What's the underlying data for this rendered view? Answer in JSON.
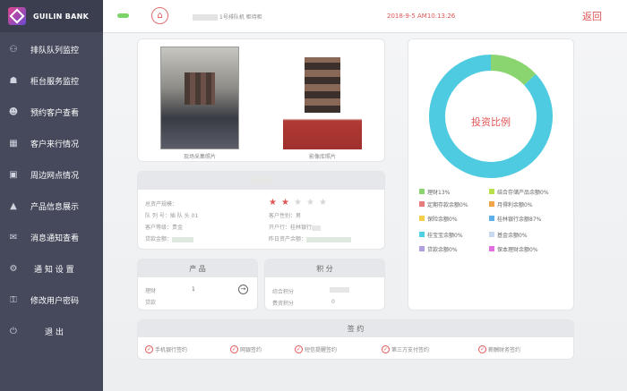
{
  "app": {
    "brand": "GUILIN BANK"
  },
  "sidebar": {
    "items": [
      {
        "label": "排队队列监控",
        "icon": "queue-monitor-icon"
      },
      {
        "label": "柜台服务监控",
        "icon": "counter-service-icon"
      },
      {
        "label": "预约客户查看",
        "icon": "appointment-icon"
      },
      {
        "label": "客户来行情况",
        "icon": "calendar-icon"
      },
      {
        "label": "周边网点情况",
        "icon": "branch-icon"
      },
      {
        "label": "产品信息展示",
        "icon": "product-icon"
      },
      {
        "label": "消息通知查看",
        "icon": "message-icon"
      },
      {
        "label": "通 知 设 置",
        "icon": "settings-icon"
      },
      {
        "label": "修改用户密码",
        "icon": "password-icon"
      },
      {
        "label": "退 出",
        "icon": "power-icon"
      }
    ]
  },
  "topbar": {
    "queue_info": "1号排队机 柜待柜",
    "timestamp": "2018-9-5 AM10:13:26",
    "back": "返回"
  },
  "photos": {
    "capture_caption": "现场采集照片",
    "library_caption": "影像库照片"
  },
  "customer": {
    "rows_left": [
      {
        "label": "总资产规模："
      },
      {
        "label": "队 列 号：插 队 头 01"
      },
      {
        "label": "客户等级：贵金"
      },
      {
        "label": "贷款金额："
      }
    ],
    "rows_right": [
      {
        "label": "客户性别：男"
      },
      {
        "label": "开户行：桂林银行"
      },
      {
        "label": "昨日资产余额："
      }
    ],
    "rating": {
      "value": 2,
      "max": 5
    }
  },
  "products": {
    "title": "产 品",
    "rows": [
      {
        "label": "理财",
        "value": "1"
      },
      {
        "label": "贷款",
        "value": ""
      }
    ]
  },
  "points": {
    "title": "积 分",
    "rows": [
      {
        "label": "综合积分",
        "value": ""
      },
      {
        "label": "费资积分",
        "value": "0"
      }
    ]
  },
  "investment": {
    "title": "投资比例",
    "legend": [
      {
        "label": "理财13%",
        "color": "#8ad56f"
      },
      {
        "label": "结合存储产品余额0%",
        "color": "#b8e04a"
      },
      {
        "label": "定期存款余额0%",
        "color": "#e77c7c"
      },
      {
        "label": "月得利余额0%",
        "color": "#f0a44a"
      },
      {
        "label": "保险余额0%",
        "color": "#f5cf4a"
      },
      {
        "label": "桂林银行余额87%",
        "color": "#5fb0e8"
      },
      {
        "label": "桂宝宝余额0%",
        "color": "#4dd0e1"
      },
      {
        "label": "基金余额0%",
        "color": "#c8d8f0"
      },
      {
        "label": "贷款余额0%",
        "color": "#b0a0e0"
      },
      {
        "label": "保本理财余额0%",
        "color": "#e070e0"
      }
    ]
  },
  "chart_data": {
    "type": "pie",
    "title": "投资比例",
    "categories": [
      "理财",
      "结合存储产品",
      "定期存款",
      "月得利",
      "保险",
      "桂林银行",
      "桂宝宝",
      "基金",
      "贷款",
      "保本理财"
    ],
    "values": [
      13,
      0,
      0,
      0,
      0,
      87,
      0,
      0,
      0,
      0
    ],
    "colors": [
      "#8ad56f",
      "#b8e04a",
      "#e77c7c",
      "#f0a44a",
      "#f5cf4a",
      "#4ecbe0",
      "#4dd0e1",
      "#c8d8f0",
      "#b0a0e0",
      "#e070e0"
    ]
  },
  "signing": {
    "title": "签 约",
    "items": [
      "手机银行签约",
      "网银签约",
      "短信提醒签约",
      "第三方支付签约",
      "薪酬财务签约"
    ]
  }
}
